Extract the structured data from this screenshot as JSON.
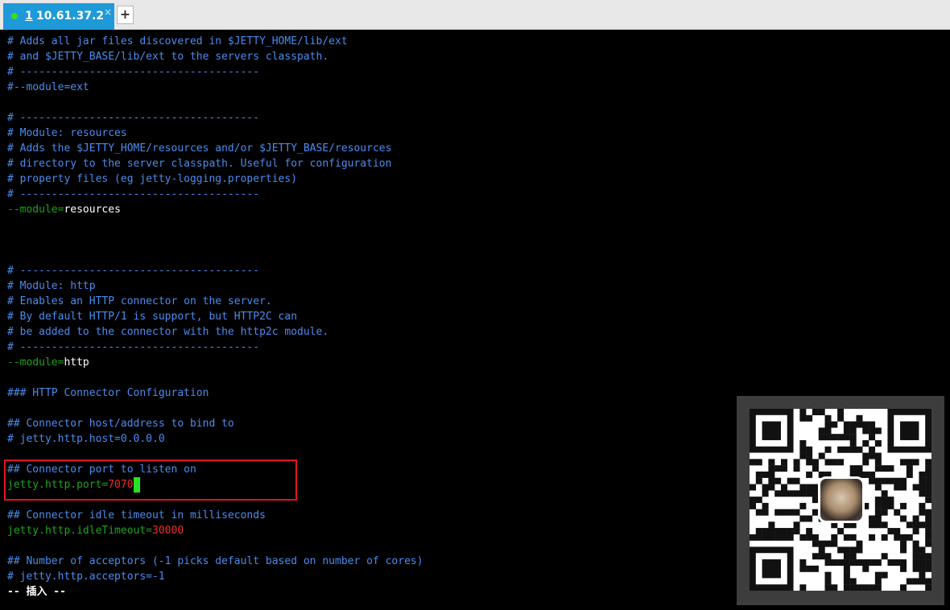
{
  "tabbar": {
    "tab": {
      "number": "1",
      "host": "10.61.37.2",
      "close": "×"
    },
    "new_tab": "+"
  },
  "terminal": {
    "lines": [
      [
        "# Adds all jar files discovered in $JETTY_HOME/lib/ext"
      ],
      [
        "# and $JETTY_BASE/lib/ext to the servers classpath."
      ],
      [
        "# --------------------------------------"
      ],
      [
        "#--module=ext"
      ],
      [
        ""
      ],
      [
        "# --------------------------------------"
      ],
      [
        "# Module: resources"
      ],
      [
        "# Adds the $JETTY_HOME/resources and/or $JETTY_BASE/resources"
      ],
      [
        "# directory to the server classpath. Useful for configuration"
      ],
      [
        "# property files (eg jetty-logging.properties)"
      ],
      [
        "# --------------------------------------"
      ],
      [
        "--module=",
        "resources"
      ],
      [
        ""
      ],
      [
        ""
      ],
      [
        ""
      ],
      [
        "# --------------------------------------"
      ],
      [
        "# Module: http"
      ],
      [
        "# Enables an HTTP connector on the server."
      ],
      [
        "# By default HTTP/1 is support, but HTTP2C can"
      ],
      [
        "# be added to the connector with the http2c module."
      ],
      [
        "# --------------------------------------"
      ],
      [
        "--module=",
        "http"
      ],
      [
        ""
      ],
      [
        "### HTTP Connector Configuration"
      ],
      [
        ""
      ],
      [
        "## Connector host/address to bind to"
      ],
      [
        "# jetty.http.host=0.0.0.0"
      ],
      [
        ""
      ],
      [
        "## Connector port to listen on"
      ],
      [
        "jetty.http.port=",
        "7070"
      ],
      [
        ""
      ],
      [
        "## Connector idle timeout in milliseconds"
      ],
      [
        "jetty.http.idleTimeout=",
        "30000"
      ],
      [
        ""
      ],
      [
        "## Number of acceptors (-1 picks default based on number of cores)"
      ],
      [
        "# jetty.http.acceptors=-1"
      ]
    ],
    "status_line": "-- 插入 --"
  },
  "colors": {
    "comment": "#4a8cf0",
    "key": "#1ca31c",
    "value_plain": "#ffffff",
    "value_number": "#ee2b2b",
    "cursor": "#22e61e",
    "highlight_box": "#e3141c",
    "tab": "#1e9ad8"
  },
  "overlay": {
    "qr_code": "qr-code-image"
  }
}
